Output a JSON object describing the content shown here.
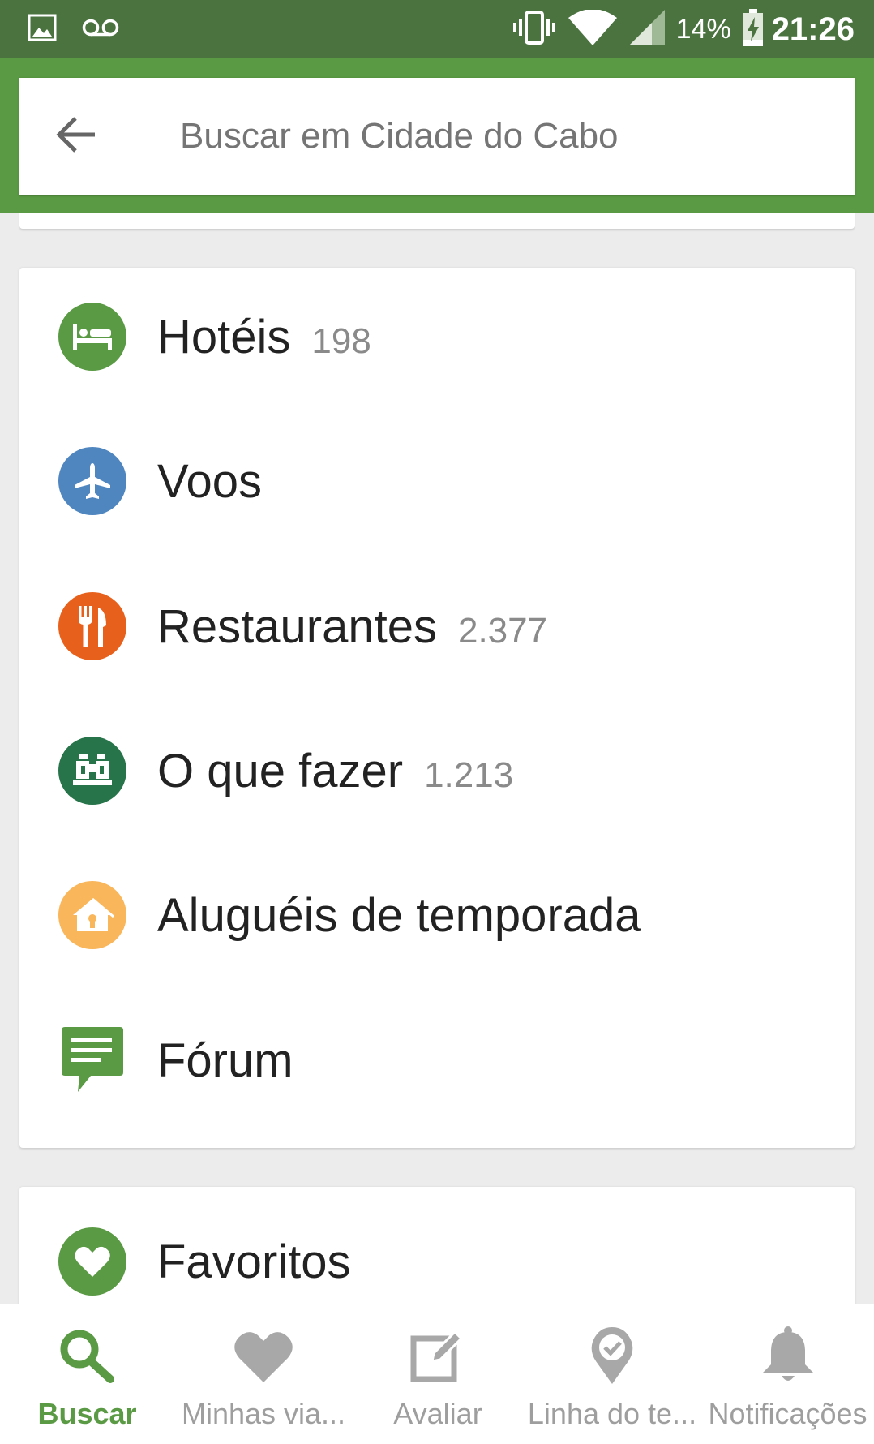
{
  "status_bar": {
    "battery": "14%",
    "time": "21:26",
    "icons": [
      "image-icon",
      "voicemail-icon",
      "vibrate-icon",
      "wifi-icon",
      "signal-icon",
      "battery-charging-icon"
    ]
  },
  "search": {
    "placeholder": "Buscar em Cidade do Cabo",
    "back_icon": "arrow-left-icon"
  },
  "categories": [
    {
      "label": "Hotéis",
      "count": "198",
      "icon": "bed-icon",
      "color": "#5a9a44"
    },
    {
      "label": "Voos",
      "count": "",
      "icon": "airplane-icon",
      "color": "#4f86c0"
    },
    {
      "label": "Restaurantes",
      "count": "2.377",
      "icon": "fork-knife-icon",
      "color": "#e8611c"
    },
    {
      "label": "O que fazer",
      "count": "1.213",
      "icon": "binoculars-icon",
      "color": "#27744a"
    },
    {
      "label": "Aluguéis de temporada",
      "count": "",
      "icon": "house-icon",
      "color": "#f9b65a"
    },
    {
      "label": "Fórum",
      "count": "",
      "icon": "chat-icon",
      "color": "#5a9a44"
    }
  ],
  "favorites": {
    "label": "Favoritos",
    "icon": "heart-icon",
    "color": "#5a9a44"
  },
  "bottom_nav": [
    {
      "label": "Buscar",
      "icon": "search-icon",
      "active": true
    },
    {
      "label": "Minhas via...",
      "icon": "heart-icon",
      "active": false
    },
    {
      "label": "Avaliar",
      "icon": "edit-icon",
      "active": false
    },
    {
      "label": "Linha do te...",
      "icon": "location-check-icon",
      "active": false
    },
    {
      "label": "Notificações",
      "icon": "bell-icon",
      "active": false
    }
  ],
  "colors": {
    "status_bar": "#4b7340",
    "header": "#5a9a44",
    "accent": "#5a9a44",
    "inactive": "#9e9e9e"
  }
}
